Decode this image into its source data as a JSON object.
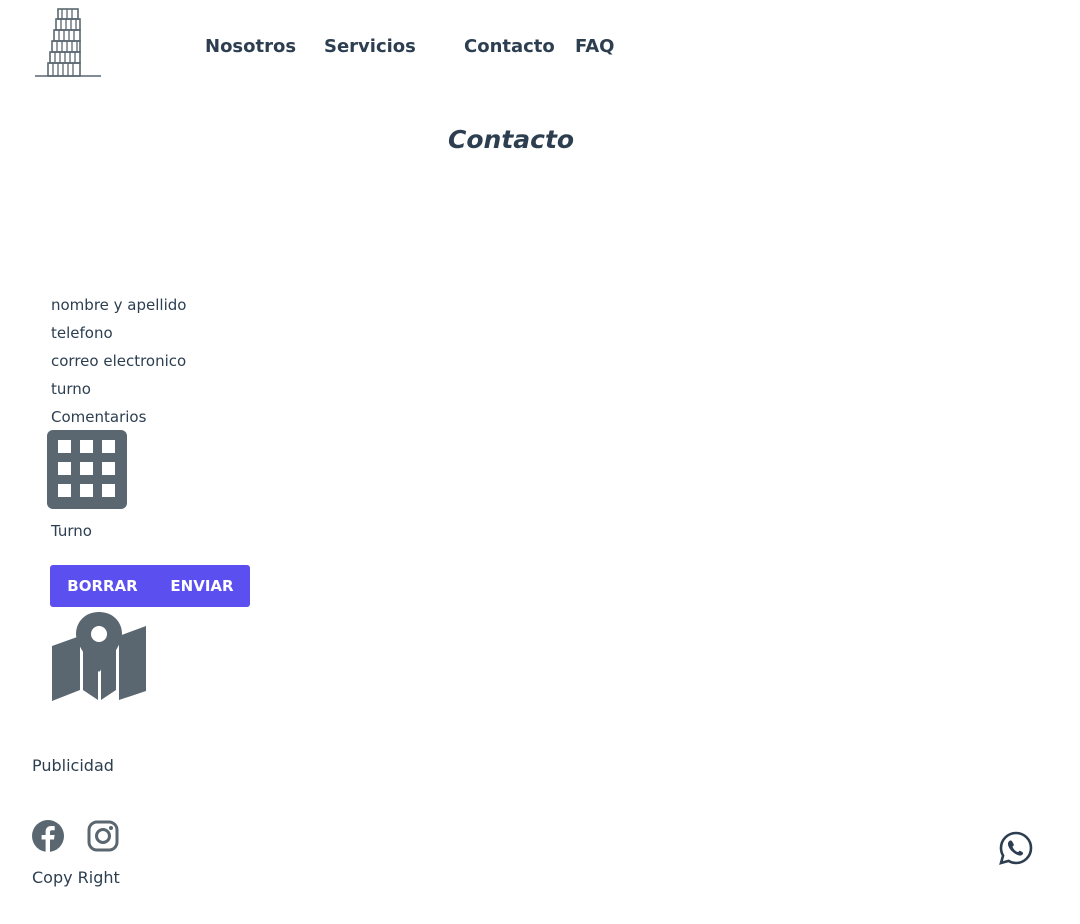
{
  "header": {
    "logo_icon": "leaning-tower-icon",
    "nav": [
      {
        "label": "Nosotros"
      },
      {
        "label": "Servicios"
      },
      {
        "label": "Contacto"
      },
      {
        "label": "FAQ"
      }
    ]
  },
  "main": {
    "title": "Contacto",
    "form": {
      "labels": {
        "name": "nombre y apellido",
        "phone": "telefono",
        "email": "correo electronico",
        "shift": "turno",
        "comments": "Comentarios",
        "turno_grid": "Turno"
      },
      "grid_icon": "calendar-grid-icon",
      "buttons": {
        "reset": "BORRAR",
        "submit": "ENVIAR"
      }
    },
    "map_icon": "map-pin-icon"
  },
  "footer": {
    "publicidad": "Publicidad",
    "social": [
      "facebook-icon",
      "instagram-icon"
    ],
    "copyright": "Copy Right",
    "whatsapp_icon": "whatsapp-icon"
  },
  "colors": {
    "text": "#2c3e50",
    "icon": "#5a6770",
    "button": "#5b4ff0"
  }
}
